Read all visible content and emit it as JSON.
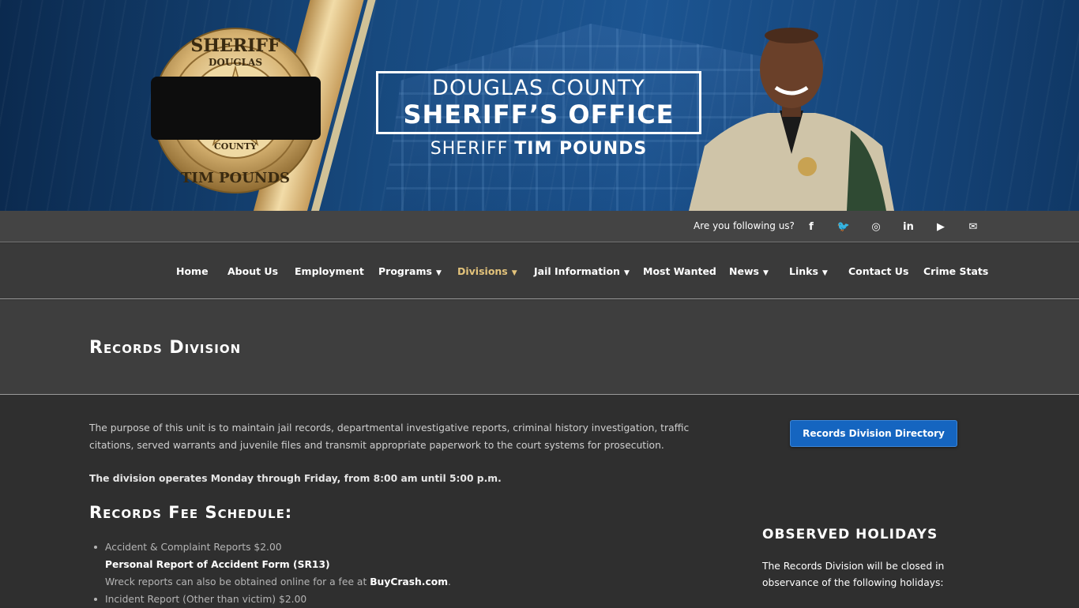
{
  "header": {
    "badge_top": "SHERIFF",
    "badge_county_top": "DOUGLAS",
    "badge_county_bottom": "COUNTY",
    "badge_bottom": "TIM POUNDS",
    "title_line1": "DOUGLAS COUNTY",
    "title_line2": "SHERIFF’S OFFICE",
    "sheriff_prefix": "SHERIFF",
    "sheriff_name": "TIM POUNDS"
  },
  "social": {
    "follow_text": "Are you following us?",
    "icons": [
      "facebook-icon",
      "twitter-icon",
      "instagram-icon",
      "linkedin-icon",
      "youtube-icon",
      "email-icon"
    ],
    "glyphs": [
      "f",
      "🐦",
      "◎",
      "in",
      "▶",
      "✉"
    ]
  },
  "nav": {
    "items": [
      {
        "label": "Home"
      },
      {
        "label": "About Us"
      },
      {
        "label": "Employment"
      },
      {
        "label": "Programs"
      },
      {
        "label": "Divisions"
      },
      {
        "label": "Jail Information"
      },
      {
        "label": "Most Wanted"
      },
      {
        "label": "News"
      },
      {
        "label": "Links"
      },
      {
        "label": "Contact Us"
      },
      {
        "label": "Crime Stats"
      }
    ],
    "active_color": "#e3c37b"
  },
  "page": {
    "title": "Records Division"
  },
  "main": {
    "intro": "The purpose of this unit is to maintain jail records, departmental investigative reports, criminal history investigation, traffic citations, served warrants and juvenile files and transmit appropriate paperwork to the court systems for prosecution.",
    "hours": "The division operates Monday through Friday, from 8:00 am until 5:00 p.m.",
    "fee_heading": "Records Fee Schedule:",
    "fees": {
      "item1": "Accident & Complaint Reports $2.00",
      "item1_form": "Personal Report of Accident Form (SR13)",
      "item1_note": "Wreck reports can also be obtained online for a fee at ",
      "item1_link": "BuyCrash.com",
      "item1_period": ".",
      "item2": "Incident Report (Other than victim) $2.00"
    }
  },
  "sidebar": {
    "directory_button": "Records Division Directory",
    "holidays_title": "OBSERVED HOLIDAYS",
    "holidays_text": "The Records Division will be closed in observance of the following holidays:",
    "button_color": "#1565c0"
  }
}
